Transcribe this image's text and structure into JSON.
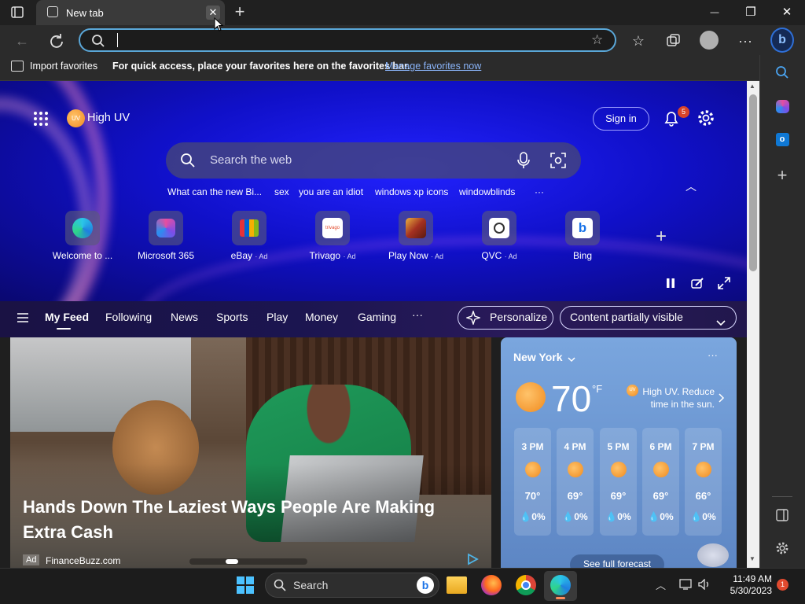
{
  "browser": {
    "tab_title": "New tab",
    "tab_close_glyph": "✕",
    "new_tab_glyph": "+",
    "window": {
      "minimize": "—",
      "restore": "❐",
      "close": "✕"
    },
    "address_placeholder": "",
    "favorites_bar": {
      "import_label": "Import favorites",
      "message": "For quick access, place your favorites here on the favorites bar.",
      "manage_link": "Manage favorites now"
    }
  },
  "ntp": {
    "weather_chip": {
      "badge": "UV",
      "label": "High UV"
    },
    "sign_in": "Sign in",
    "notification_count": "5",
    "search_placeholder": "Search the web",
    "quick_links": [
      "What can the new Bi...",
      "sex",
      "you are an idiot",
      "windows xp icons",
      "windowblinds",
      "···"
    ],
    "tiles": [
      {
        "label": "Welcome to ...",
        "ad": ""
      },
      {
        "label": "Microsoft 365",
        "ad": ""
      },
      {
        "label": "eBay",
        "ad": "· Ad"
      },
      {
        "label": "Trivago",
        "ad": "· Ad"
      },
      {
        "label": "Play Now",
        "ad": "· Ad"
      },
      {
        "label": "QVC",
        "ad": "· Ad"
      },
      {
        "label": "Bing",
        "ad": ""
      }
    ],
    "trivago_text": "trivago",
    "add_tile": "+",
    "feed_tabs": [
      "My Feed",
      "Following",
      "News",
      "Sports",
      "Play",
      "Money",
      "Gaming",
      "···"
    ],
    "personalize": "Personalize",
    "content_visibility": "Content partially visible"
  },
  "article": {
    "headline": "Hands Down The Laziest Ways People Are Making Extra Cash",
    "ad_badge": "Ad",
    "source": "FinanceBuzz.com"
  },
  "weather": {
    "location": "New York",
    "temperature": "70",
    "unit": "°F",
    "uv_badge": "UV",
    "alert": "High UV. Reduce time in the sun.",
    "hours": [
      {
        "time": "3 PM",
        "temp": "70°",
        "precip": "0%"
      },
      {
        "time": "4 PM",
        "temp": "69°",
        "precip": "0%"
      },
      {
        "time": "5 PM",
        "temp": "69°",
        "precip": "0%"
      },
      {
        "time": "6 PM",
        "temp": "69°",
        "precip": "0%"
      },
      {
        "time": "7 PM",
        "temp": "66°",
        "precip": "0%"
      }
    ],
    "full_forecast": "See full forecast",
    "menu_glyph": "···"
  },
  "taskbar": {
    "search_label": "Search",
    "time": "11:49 AM",
    "date": "5/30/2023",
    "notification_count": "1"
  },
  "colors": {
    "accent": "#5aa7d8",
    "hero": "#1414d8",
    "link": "#8ab4f8"
  }
}
